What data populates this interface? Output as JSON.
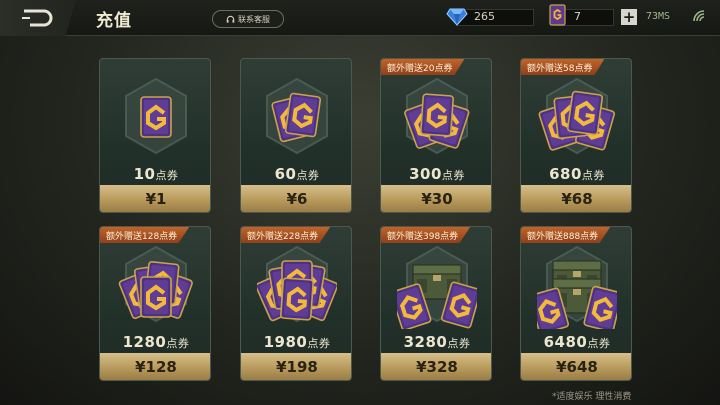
{
  "header": {
    "title": "充值",
    "service_label": "联系客服",
    "gems": "265",
    "tickets": "7",
    "ping": "73MS"
  },
  "packages": [
    {
      "amount": "10",
      "unit": "点券",
      "price": "¥1",
      "bonus": ""
    },
    {
      "amount": "60",
      "unit": "点券",
      "price": "¥6",
      "bonus": ""
    },
    {
      "amount": "300",
      "unit": "点券",
      "price": "¥30",
      "bonus": "额外赠送20点券"
    },
    {
      "amount": "680",
      "unit": "点券",
      "price": "¥68",
      "bonus": "额外赠送58点券"
    },
    {
      "amount": "1280",
      "unit": "点券",
      "price": "¥128",
      "bonus": "额外赠送128点券"
    },
    {
      "amount": "1980",
      "unit": "点券",
      "price": "¥198",
      "bonus": "额外赠送228点券"
    },
    {
      "amount": "3280",
      "unit": "点券",
      "price": "¥328",
      "bonus": "额外赠送398点券"
    },
    {
      "amount": "6480",
      "unit": "点券",
      "price": "¥648",
      "bonus": "额外赠送888点券"
    }
  ],
  "footer": {
    "note": "*适度娱乐 理性消费"
  },
  "colors": {
    "gold": "#d6bf8a",
    "purple": "#5b3a8e",
    "bonus": "#c0642a"
  },
  "icons": {
    "back": "back-arrow-icon",
    "gem": "diamond-icon",
    "ticket": "ticket-icon",
    "service": "headset-icon",
    "signal": "wifi-signal-icon"
  }
}
